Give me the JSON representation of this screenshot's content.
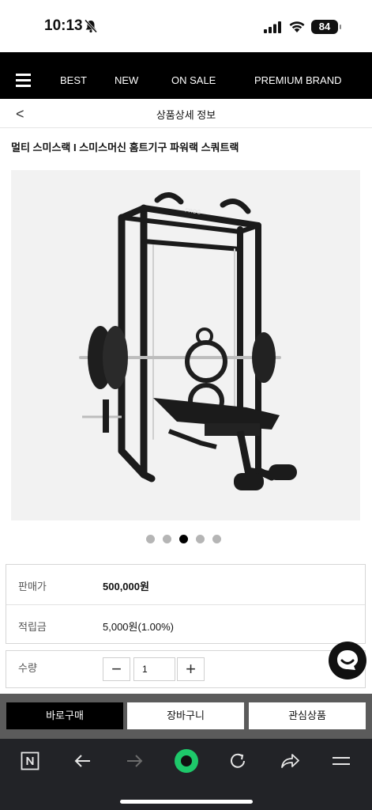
{
  "status_bar": {
    "time": "10:13",
    "battery": "84"
  },
  "nav": {
    "items": [
      "BEST",
      "NEW",
      "ON SALE",
      "PREMIUM BRAND"
    ]
  },
  "subheader": {
    "back": "<",
    "title": "상품상세 정보"
  },
  "product": {
    "title": "멀티 스미스랙 I 스미스머신 홈트기구 파워랙 스쿼트랙",
    "image_brand_mark": "FROG",
    "carousel": {
      "count": 5,
      "active": 3
    },
    "price_label": "판매가",
    "price": "500,000원",
    "points_label": "적립금",
    "points": "5,000원(1.00%)",
    "qty_label": "수량",
    "qty_value": "1",
    "minus": "−",
    "plus": "+"
  },
  "actions": {
    "buy_now": "바로구매",
    "cart": "장바구니",
    "wishlist": "관심상품"
  },
  "browser_bar": {
    "icons": [
      "naver-n-icon",
      "back-arrow-icon",
      "forward-arrow-icon",
      "green-dot-icon",
      "reload-icon",
      "share-icon",
      "menu-icon"
    ]
  }
}
